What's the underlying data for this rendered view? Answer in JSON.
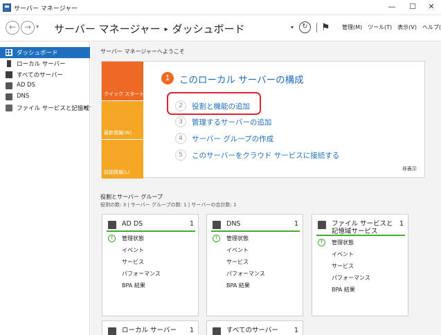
{
  "window": {
    "title": "サーバー マネージャー",
    "min": "—",
    "max": "☐",
    "close": "✕"
  },
  "header": {
    "back": "←",
    "forward": "→",
    "dropdown": "▾",
    "crumb_root": "サーバー マネージャー",
    "crumb_sep": "▸",
    "crumb_page": "ダッシュボード",
    "refresh": "↻",
    "flag": "⚑",
    "menu": [
      "管理(M)",
      "ツール(T)",
      "表示(V)",
      "ヘルプ(H)"
    ]
  },
  "sidebar": {
    "items": [
      {
        "label": "ダッシュボード",
        "icon": "dashboard-icon",
        "active": true
      },
      {
        "label": "ローカル サーバー",
        "icon": "server-icon"
      },
      {
        "label": "すべてのサーバー",
        "icon": "servers-icon"
      },
      {
        "label": "AD DS",
        "icon": "adds-icon"
      },
      {
        "label": "DNS",
        "icon": "dns-icon"
      },
      {
        "label": "ファイル サービスと記憶域サ...",
        "icon": "file-services-icon"
      }
    ],
    "chevron": "▸"
  },
  "welcome": {
    "heading": "サーバー マネージャーへようこそ",
    "quick_start": "クイック スタート(Q)",
    "whats_new": "最新情報(W)",
    "learn_more": "詳細情報(L)",
    "config_num": "1",
    "config_title": "このローカル サーバーの構成",
    "steps": [
      {
        "num": "2",
        "label": "役割と機能の追加"
      },
      {
        "num": "3",
        "label": "管理するサーバーの追加"
      },
      {
        "num": "4",
        "label": "サーバー グループの作成"
      },
      {
        "num": "5",
        "label": "このサーバーをクラウド サービスに接続する"
      }
    ],
    "hide": "非表示"
  },
  "roles": {
    "title": "役割とサーバー グループ",
    "summary": "役割の数: 3 | サーバー グループの数: 1 | サーバーの合計数: 1",
    "tiles": [
      {
        "name": "AD DS",
        "count": "1",
        "rows": [
          "管理状態",
          "イベント",
          "サービス",
          "パフォーマンス",
          "BPA 結果"
        ]
      },
      {
        "name": "DNS",
        "count": "1",
        "rows": [
          "管理状態",
          "イベント",
          "サービス",
          "パフォーマンス",
          "BPA 結果"
        ]
      },
      {
        "name": "ファイル サービスと記憶域サービス",
        "count": "1",
        "rows": [
          "管理状態",
          "イベント",
          "サービス",
          "パフォーマンス",
          "BPA 結果"
        ]
      }
    ],
    "bottom_tiles": [
      {
        "name": "ローカル サーバー",
        "count": "1"
      },
      {
        "name": "すべてのサーバー",
        "count": "1"
      }
    ],
    "ok_icon": "↑"
  },
  "colors": {
    "accent": "#1e6fc0",
    "quick_start": "#ee6a24",
    "side_blocks": "#f5a623",
    "status_ok": "#3fae2a",
    "highlight": "#e0242f"
  }
}
